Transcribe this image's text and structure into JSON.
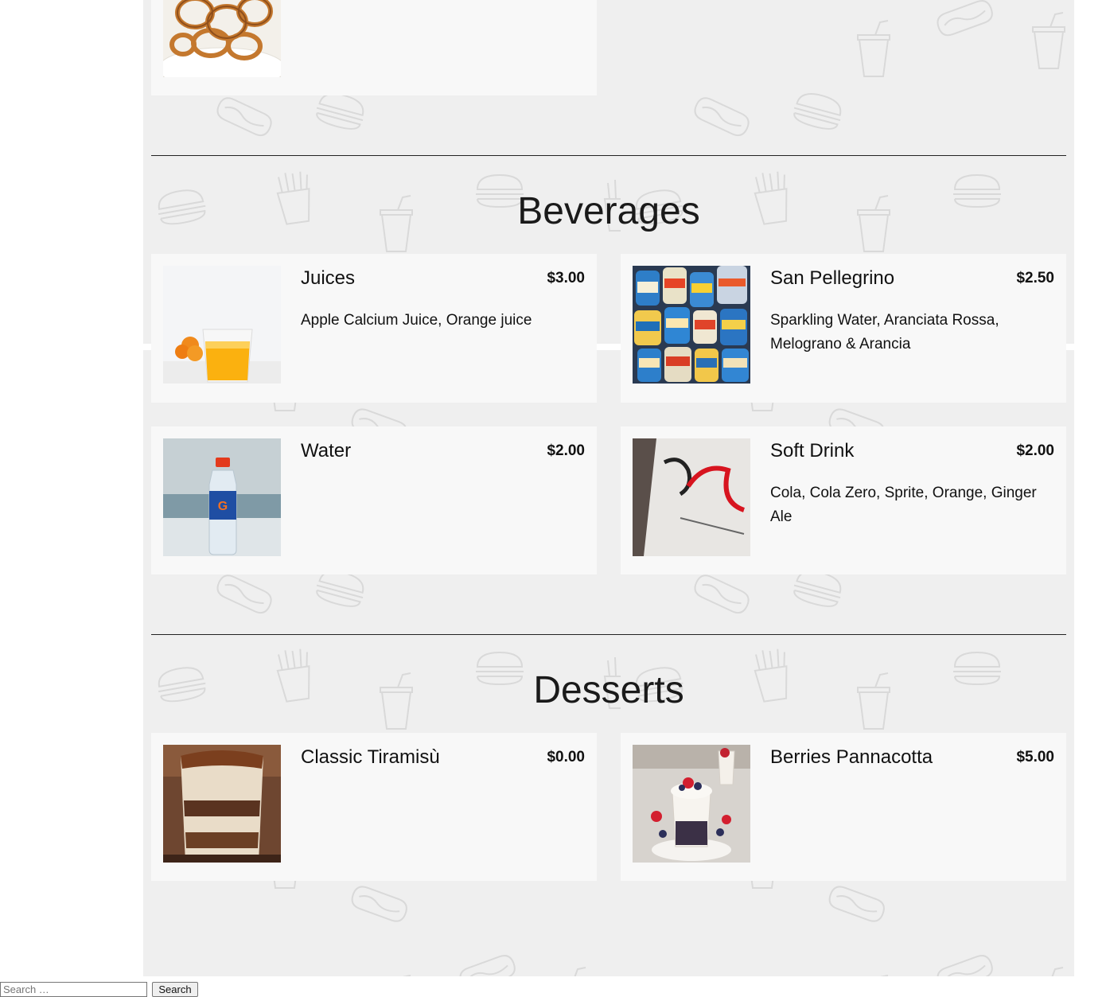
{
  "previous_section": {
    "image": "onion-rings-photo"
  },
  "sections": [
    {
      "title": "Beverages",
      "items": [
        {
          "name": "Juices",
          "price": "$3.00",
          "description": "Apple Calcium Juice, Orange juice",
          "image": "orange-juice-photo"
        },
        {
          "name": "San Pellegrino",
          "price": "$2.50",
          "description": "Sparkling Water, Aranciata Rossa, Melograno & Arancia",
          "image": "san-pellegrino-cans-photo"
        },
        {
          "name": "Water",
          "price": "$2.00",
          "description": "",
          "image": "water-bottle-photo"
        },
        {
          "name": "Soft Drink",
          "price": "$2.00",
          "description": "Cola, Cola Zero, Sprite, Orange, Ginger Ale",
          "image": "diet-coke-photo"
        }
      ]
    },
    {
      "title": "Desserts",
      "items": [
        {
          "name": "Classic Tiramisù",
          "price": "$0.00",
          "description": "",
          "image": "tiramisu-photo"
        },
        {
          "name": "Berries Pannacotta",
          "price": "$5.00",
          "description": "",
          "image": "berries-pannacotta-photo"
        }
      ]
    }
  ],
  "search": {
    "placeholder": "Search …",
    "button_label": "Search"
  },
  "colors": {
    "page_background": "#efefef",
    "card_background": "#f8f8f8",
    "divider": "#222222"
  }
}
